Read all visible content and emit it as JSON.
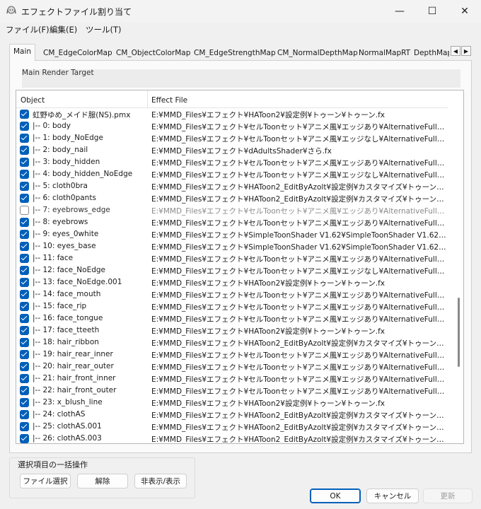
{
  "window": {
    "title": "エフェクトファイル割り当て",
    "minimize": "—",
    "maximize": "☐",
    "close": "✕"
  },
  "menu": [
    "ファイル(F)",
    "編集(E)",
    "ツール(T)"
  ],
  "tabs": [
    "Main",
    "CM_EdgeColorMap",
    "CM_ObjectColorMap",
    "CM_EdgeStrengthMap",
    "CM_NormalDepthMap",
    "NormalMapRT",
    "DepthMap"
  ],
  "tab_scroll": {
    "left": "◀",
    "right": "▶"
  },
  "render_target": "Main Render Target",
  "columns": {
    "object": "Object",
    "effect": "Effect File"
  },
  "rows": [
    {
      "object": "虹野ゆめ_メイド服(NS).pmx",
      "effect": "E:¥MMD_Files¥エフェクト¥HAToon2¥設定例¥トゥーン¥トゥーン.fx"
    },
    {
      "object": "|-- 0: body",
      "effect": "E:¥MMD_Files¥エフェクト¥セルToonセット¥アニメ風¥エッジあり¥AlternativeFull_edge_s..."
    },
    {
      "object": "|-- 1: body_NoEdge",
      "effect": "E:¥MMD_Files¥エフェクト¥セルToonセット¥アニメ風¥エッジなし¥AlternativeFull_edge_s..."
    },
    {
      "object": "|-- 2: body_nail",
      "effect": "E:¥MMD_Files¥エフェクト¥dAdultsShader¥さら.fx"
    },
    {
      "object": "|-- 3: body_hidden",
      "effect": "E:¥MMD_Files¥エフェクト¥セルToonセット¥アニメ風¥エッジあり¥AlternativeFull_edge_s..."
    },
    {
      "object": "|-- 4: body_hidden_NoEdge",
      "effect": "E:¥MMD_Files¥エフェクト¥セルToonセット¥アニメ風¥エッジなし¥AlternativeFull_edge_s..."
    },
    {
      "object": "|-- 5: cloth0bra",
      "effect": "E:¥MMD_Files¥エフェクト¥HAToon2_EditByAzolt¥設定例¥カスタマイズ¥トゥーン服¥トゥ..."
    },
    {
      "object": "|-- 6: cloth0pants",
      "effect": "E:¥MMD_Files¥エフェクト¥HAToon2_EditByAzolt¥設定例¥カスタマイズ¥トゥーン服¥トゥ..."
    },
    {
      "object": "|-- 7: eyebrows_edge",
      "effect": "E:¥MMD_Files¥エフェクト¥セルToonセット¥アニメ風¥エッジあり¥AlternativeFull_edge_h...",
      "unchecked": true
    },
    {
      "object": "|-- 8: eyebrows",
      "effect": "E:¥MMD_Files¥エフェクト¥セルToonセット¥アニメ風¥エッジあり¥AlternativeFull_edge_h..."
    },
    {
      "object": "|-- 9: eyes_0white",
      "effect": "E:¥MMD_Files¥エフェクト¥SimpleToonShader V1.62¥SimpleToonShader V1.62¥MMD¥..."
    },
    {
      "object": "|-- 10: eyes_base",
      "effect": "E:¥MMD_Files¥エフェクト¥SimpleToonShader V1.62¥SimpleToonShader V1.62¥MMD¥..."
    },
    {
      "object": "|-- 11: face",
      "effect": "E:¥MMD_Files¥エフェクト¥セルToonセット¥アニメ風¥エッジあり¥AlternativeFull_edge_s..."
    },
    {
      "object": "|-- 12: face_NoEdge",
      "effect": "E:¥MMD_Files¥エフェクト¥セルToonセット¥アニメ風¥エッジなし¥AlternativeFull_edge_s..."
    },
    {
      "object": "|-- 13: face_NoEdge.001",
      "effect": "E:¥MMD_Files¥エフェクト¥HAToon2¥設定例¥トゥーン¥トゥーン.fx"
    },
    {
      "object": "|-- 14: face_mouth",
      "effect": "E:¥MMD_Files¥エフェクト¥セルToonセット¥アニメ風¥エッジあり¥AlternativeFull_edge_s..."
    },
    {
      "object": "|-- 15: face_rip",
      "effect": "E:¥MMD_Files¥エフェクト¥セルToonセット¥アニメ風¥エッジあり¥AlternativeFull_edge_s..."
    },
    {
      "object": "|-- 16: face_tongue",
      "effect": "E:¥MMD_Files¥エフェクト¥セルToonセット¥アニメ風¥エッジあり¥AlternativeFull_edge_s..."
    },
    {
      "object": "|-- 17: face_tteeth",
      "effect": "E:¥MMD_Files¥エフェクト¥HAToon2¥設定例¥トゥーン¥トゥーン.fx"
    },
    {
      "object": "|-- 18: hair_ribbon",
      "effect": "E:¥MMD_Files¥エフェクト¥HAToon2_EditByAzolt¥設定例¥カスタマイズ¥トゥーン服¥トゥ..."
    },
    {
      "object": "|-- 19: hair_rear_inner",
      "effect": "E:¥MMD_Files¥エフェクト¥セルToonセット¥アニメ風¥エッジあり¥AlternativeFull_edge_h..."
    },
    {
      "object": "|-- 20: hair_rear_outer",
      "effect": "E:¥MMD_Files¥エフェクト¥セルToonセット¥アニメ風¥エッジあり¥AlternativeFull_edge_h..."
    },
    {
      "object": "|-- 21: hair_front_inner",
      "effect": "E:¥MMD_Files¥エフェクト¥セルToonセット¥アニメ風¥エッジあり¥AlternativeFull_edge_h..."
    },
    {
      "object": "|-- 22: hair_front_outer",
      "effect": "E:¥MMD_Files¥エフェクト¥セルToonセット¥アニメ風¥エッジあり¥AlternativeFull_edge_h..."
    },
    {
      "object": "|-- 23: x_blush_line",
      "effect": "E:¥MMD_Files¥エフェクト¥HAToon2¥設定例¥トゥーン¥トゥーン.fx"
    },
    {
      "object": "|-- 24: clothAS",
      "effect": "E:¥MMD_Files¥エフェクト¥HAToon2_EditByAzolt¥設定例¥カスタマイズ¥トゥーン服¥トゥ..."
    },
    {
      "object": "|-- 25: clothAS.001",
      "effect": "E:¥MMD_Files¥エフェクト¥HAToon2_EditByAzolt¥設定例¥カスタマイズ¥トゥーン服¥トゥ..."
    },
    {
      "object": "|-- 26: clothAS.003",
      "effect": "E:¥MMD_Files¥エフェクト¥HAToon2_EditByAzolt¥設定例¥カスタマイズ¥トゥーン服¥トゥ..."
    }
  ],
  "batch": {
    "title": "選択項目の一括操作",
    "select_file": "ファイル選択",
    "release": "解除",
    "toggle_visibility": "非表示/表示"
  },
  "dialog": {
    "ok": "OK",
    "cancel": "キャンセル",
    "update": "更新"
  },
  "colors": {
    "accent": "#005fb8",
    "background": "#f0f0f0",
    "list_background": "#ffffff"
  },
  "icons": {
    "app": "mmd-character-icon"
  }
}
